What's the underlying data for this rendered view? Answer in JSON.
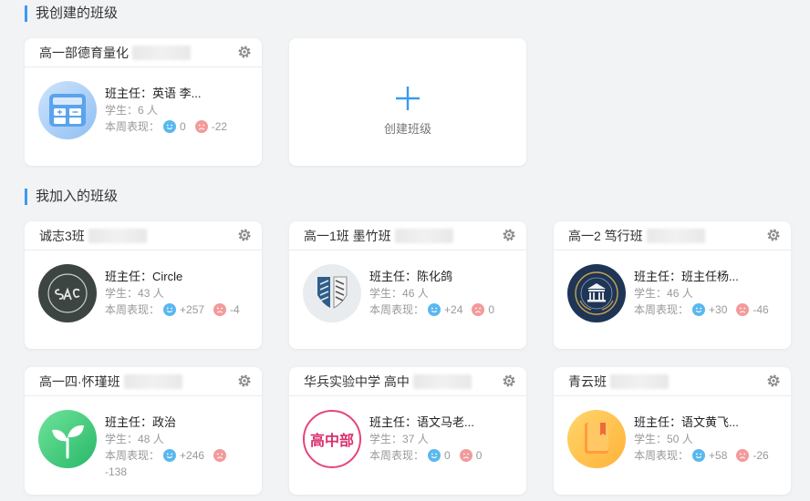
{
  "sections": {
    "created_title": "我创建的班级",
    "joined_title": "我加入的班级"
  },
  "labels": {
    "teacher_prefix": "班主任：",
    "students_prefix": "学生：",
    "students_unit": " 人",
    "perf_prefix": "本周表现："
  },
  "create_card": {
    "label": "创建班级"
  },
  "created_classes": [
    {
      "name": "高一部德育量化",
      "teacher": "英语 李...",
      "students": "6",
      "good": "0",
      "bad": "-22",
      "avatar": "calculator"
    }
  ],
  "joined_classes": [
    {
      "name": "诚志3班",
      "teacher": "Circle",
      "students": "43",
      "good": "+257",
      "bad": "-4",
      "avatar": "sac"
    },
    {
      "name": "高一1班 墨竹班",
      "teacher": "陈化鸽",
      "students": "46",
      "good": "+24",
      "bad": "0",
      "avatar": "wings"
    },
    {
      "name": "高一2 笃行班",
      "teacher": "班主任杨...",
      "students": "46",
      "good": "+30",
      "bad": "-46",
      "avatar": "school-emblem"
    },
    {
      "name": "高一四·怀瑾班",
      "teacher": "政治",
      "students": "48",
      "good": "+246",
      "bad": "-138",
      "avatar": "sprout"
    },
    {
      "name": "华兵实验中学 高中",
      "teacher": "语文马老...",
      "students": "37",
      "good": "0",
      "bad": "0",
      "avatar": "gaozhongbu",
      "avatar_text": "高中部"
    },
    {
      "name": "青云班",
      "teacher": "语文黄飞...",
      "students": "50",
      "good": "+58",
      "bad": "-26",
      "avatar": "book"
    }
  ],
  "colors": {
    "accent": "#3a9bf0",
    "happy": "#5ab8ef",
    "sad": "#f39a9a"
  }
}
